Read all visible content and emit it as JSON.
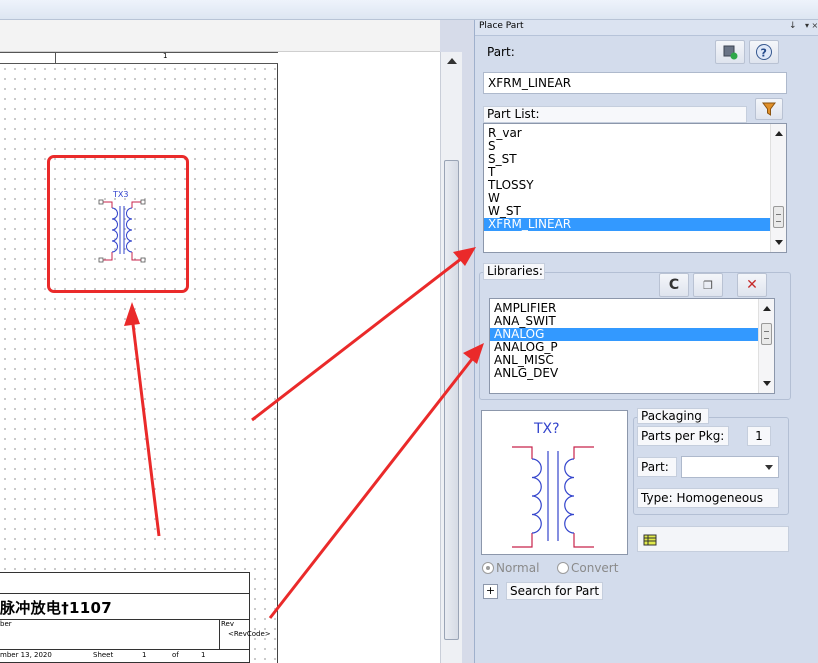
{
  "panel": {
    "title": "Place Part",
    "pin_glyph": "↓",
    "menu_glyph": "▾ ×"
  },
  "part": {
    "label": "Part:",
    "value": "XFRM_LINEAR"
  },
  "part_list": {
    "label": "Part List:",
    "items": [
      "R_var",
      "S",
      "S_ST",
      "T",
      "TLOSSY",
      "W",
      "W_ST",
      "XFRM_LINEAR"
    ],
    "selected": "XFRM_LINEAR"
  },
  "libraries": {
    "label": "Libraries:",
    "items": [
      "AMPLIFIER",
      "ANA_SWIT",
      "ANALOG",
      "ANALOG_P",
      "ANL_MISC",
      "ANLG_DEV"
    ],
    "selected": "ANALOG",
    "refresh_glyph": "C",
    "add_glyph": "❐",
    "remove_glyph": "✕"
  },
  "preview": {
    "ref": "TX?"
  },
  "packaging": {
    "heading": "Packaging",
    "parts_per_pkg_label": "Parts per Pkg:",
    "parts_per_pkg_value": "1",
    "part_label": "Part:",
    "part_value": "",
    "type_label": "Type:",
    "type_value": "Homogeneous"
  },
  "radios": {
    "normal": "Normal",
    "convert": "Convert"
  },
  "search": {
    "plus": "+",
    "label": "Search for Part"
  },
  "schematic": {
    "ruler_number": "1",
    "part_ref": "TX3",
    "title": "脉冲放电†1107",
    "number_label": "ber",
    "rev_label": "Rev",
    "rev_code": "<RevCode>",
    "date": "mber 13, 2020",
    "sheet_label": "Sheet",
    "sheet_num": "1",
    "of_label": "of",
    "sheet_total": "1"
  },
  "colors": {
    "selection": "#3399ff",
    "annotation": "#ea2a2a",
    "panel_bg": "#d3dcec",
    "symbol_blue": "#3344cc",
    "symbol_pin": "#c8234b"
  }
}
